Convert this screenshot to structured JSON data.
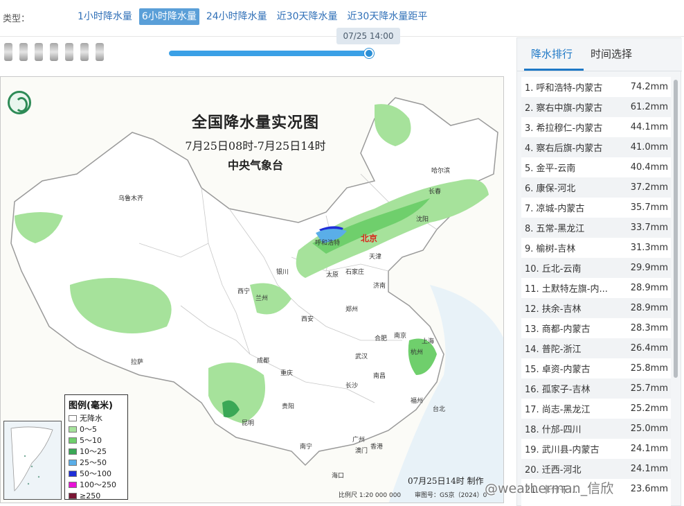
{
  "typebar": {
    "label": "类型：",
    "tabs": [
      {
        "label": "1小时降水量",
        "active": false
      },
      {
        "label": "6小时降水量",
        "active": true
      },
      {
        "label": "24小时降水量",
        "active": false
      },
      {
        "label": "近30天降水量",
        "active": false
      },
      {
        "label": "近30天降水量距平",
        "active": false
      }
    ]
  },
  "timeline": {
    "current_time": "07/25 14:00",
    "progress_fraction": 1.0
  },
  "map": {
    "title": "全国降水量实况图",
    "period": "7月25日08时-7月25日14时",
    "agency": "中央气象台",
    "made_note": "07月25日14时 制作",
    "scale_note": "比例尺 1:20 000 000",
    "review_note": "审图号：GS京（2024）0",
    "capital": "北京",
    "cities": [
      "乌鲁木齐",
      "哈尔滨",
      "长春",
      "沈阳",
      "呼和浩特",
      "天津",
      "银川",
      "太原",
      "石家庄",
      "西宁",
      "兰州",
      "济南",
      "西安",
      "郑州",
      "合肥",
      "南京",
      "上海",
      "成都",
      "武汉",
      "杭州",
      "拉萨",
      "重庆",
      "长沙",
      "南昌",
      "福州",
      "贵阳",
      "昆明",
      "台北",
      "南宁",
      "广州",
      "香港",
      "澳门",
      "海口"
    ],
    "legend": {
      "title": "图例(毫米)",
      "items": [
        {
          "label": "无降水",
          "color": "#ffffff"
        },
        {
          "label": "0～5",
          "color": "#a6e29b"
        },
        {
          "label": "5～10",
          "color": "#6fcf6c"
        },
        {
          "label": "10～25",
          "color": "#3aa856"
        },
        {
          "label": "25～50",
          "color": "#5aaee8"
        },
        {
          "label": "50～100",
          "color": "#1f2fd8"
        },
        {
          "label": "100～250",
          "color": "#e812d6"
        },
        {
          "label": "≥250",
          "color": "#7a1534"
        }
      ]
    }
  },
  "ranking": {
    "tabs": [
      {
        "label": "降水排行",
        "active": true
      },
      {
        "label": "时间选择",
        "active": false
      }
    ],
    "items": [
      {
        "name": "1. 呼和浩特-内蒙古",
        "value": "74.2mm"
      },
      {
        "name": "2. 察右中旗-内蒙古",
        "value": "61.2mm"
      },
      {
        "name": "3. 希拉穆仁-内蒙古",
        "value": "44.1mm"
      },
      {
        "name": "4. 察右后旗-内蒙古",
        "value": "41.0mm"
      },
      {
        "name": "5. 金平-云南",
        "value": "40.4mm"
      },
      {
        "name": "6. 康保-河北",
        "value": "37.2mm"
      },
      {
        "name": "7. 凉城-内蒙古",
        "value": "35.7mm"
      },
      {
        "name": "8. 五常-黑龙江",
        "value": "33.7mm"
      },
      {
        "name": "9. 榆树-吉林",
        "value": "31.3mm"
      },
      {
        "name": "10. 丘北-云南",
        "value": "29.9mm"
      },
      {
        "name": "11. 土默特左旗-内...",
        "value": "28.9mm"
      },
      {
        "name": "12. 扶余-吉林",
        "value": "28.9mm"
      },
      {
        "name": "13. 商都-内蒙古",
        "value": "28.3mm"
      },
      {
        "name": "14. 普陀-浙江",
        "value": "26.4mm"
      },
      {
        "name": "15. 卓资-内蒙古",
        "value": "25.8mm"
      },
      {
        "name": "16. 孤家子-吉林",
        "value": "25.7mm"
      },
      {
        "name": "17. 尚志-黑龙江",
        "value": "25.2mm"
      },
      {
        "name": "18. 什邡-四川",
        "value": "25.0mm"
      },
      {
        "name": "19. 武川县-内蒙古",
        "value": "24.1mm"
      },
      {
        "name": "20. 迁西-河北",
        "value": "24.1mm"
      },
      {
        "name": "21. 卡什干...",
        "value": "23.6mm"
      }
    ]
  },
  "watermark": "@weatherman_信欣"
}
